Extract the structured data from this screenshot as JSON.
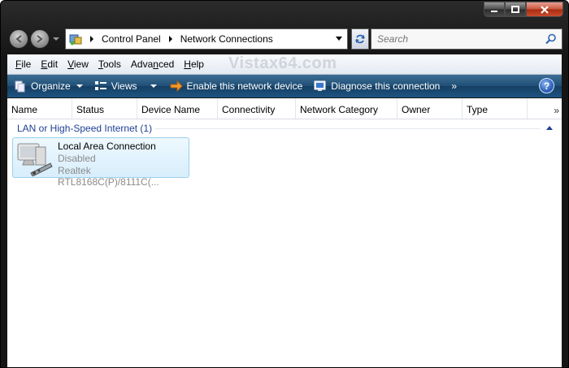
{
  "window": {
    "caption_buttons": [
      "minimize-icon",
      "maximize-icon",
      "close-icon"
    ]
  },
  "address": {
    "crumbs": [
      "Control Panel",
      "Network Connections"
    ]
  },
  "search": {
    "placeholder": "Search"
  },
  "menu": {
    "items": [
      {
        "pre": "",
        "u": "F",
        "post": "ile"
      },
      {
        "pre": "",
        "u": "E",
        "post": "dit"
      },
      {
        "pre": "",
        "u": "V",
        "post": "iew"
      },
      {
        "pre": "",
        "u": "T",
        "post": "ools"
      },
      {
        "pre": "Adva",
        "u": "n",
        "post": "ced"
      },
      {
        "pre": "",
        "u": "H",
        "post": "elp"
      }
    ],
    "watermark": "Vistax64.com"
  },
  "toolbar": {
    "organize": "Organize",
    "views": "Views",
    "enable": "Enable this network device",
    "diagnose": "Diagnose this connection",
    "more": "»",
    "help": "?"
  },
  "columns": {
    "headers": [
      "Name",
      "Status",
      "Device Name",
      "Connectivity",
      "Network Category",
      "Owner",
      "Type"
    ],
    "more": "»"
  },
  "group": {
    "title": "LAN or High-Speed Internet (1)"
  },
  "connection": {
    "name": "Local Area Connection",
    "status": "Disabled",
    "device": "Realtek RTL8168C(P)/8111C(..."
  },
  "colors": {
    "command_bar": "#1f4f77",
    "group_title": "#1e3f95",
    "tile_border": "#9cd0ec"
  }
}
